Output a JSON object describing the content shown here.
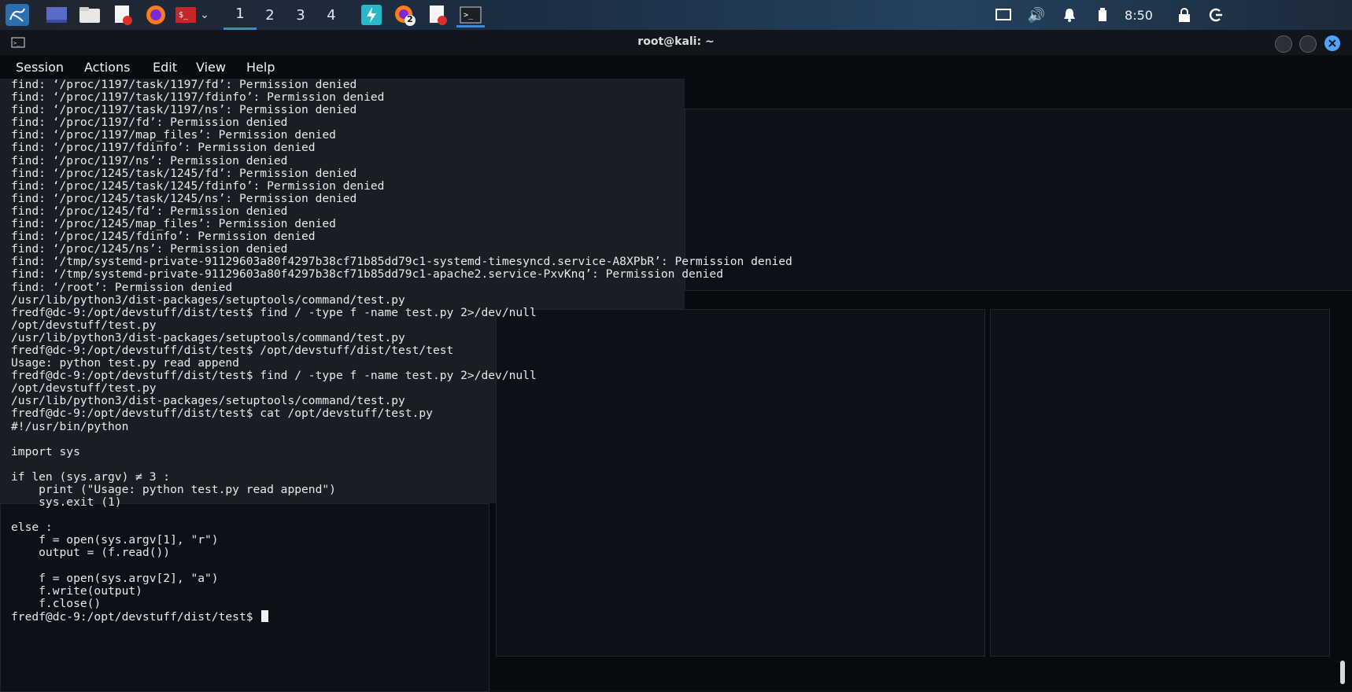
{
  "panel": {
    "apps": [
      "kali-menu-icon",
      "desktop-icon",
      "file-manager-icon",
      "text-editor-icon",
      "firefox-icon",
      "terminal-app-icon",
      "dropdown-chevron-icon"
    ],
    "workspaces": [
      "1",
      "2",
      "3",
      "4"
    ],
    "running_badge": "2",
    "clock": "8:50"
  },
  "window": {
    "title": "root@kali: ~",
    "menu": [
      "Session",
      "Actions",
      "Edit",
      "View",
      "Help"
    ]
  },
  "terminal": {
    "lines": [
      "find: ‘/proc/1197/task/1197/fd’: Permission denied",
      "find: ‘/proc/1197/task/1197/fdinfo’: Permission denied",
      "find: ‘/proc/1197/task/1197/ns’: Permission denied",
      "find: ‘/proc/1197/fd’: Permission denied",
      "find: ‘/proc/1197/map_files’: Permission denied",
      "find: ‘/proc/1197/fdinfo’: Permission denied",
      "find: ‘/proc/1197/ns’: Permission denied",
      "find: ‘/proc/1245/task/1245/fd’: Permission denied",
      "find: ‘/proc/1245/task/1245/fdinfo’: Permission denied",
      "find: ‘/proc/1245/task/1245/ns’: Permission denied",
      "find: ‘/proc/1245/fd’: Permission denied",
      "find: ‘/proc/1245/map_files’: Permission denied",
      "find: ‘/proc/1245/fdinfo’: Permission denied",
      "find: ‘/proc/1245/ns’: Permission denied",
      "find: ‘/tmp/systemd-private-91129603a80f4297b38cf71b85dd79c1-systemd-timesyncd.service-A8XPbR’: Permission denied",
      "find: ‘/tmp/systemd-private-91129603a80f4297b38cf71b85dd79c1-apache2.service-PxvKnq’: Permission denied",
      "find: ‘/root’: Permission denied",
      "/usr/lib/python3/dist-packages/setuptools/command/test.py",
      "fredf@dc-9:/opt/devstuff/dist/test$ find / -type f -name test.py 2>/dev/null",
      "/opt/devstuff/test.py",
      "/usr/lib/python3/dist-packages/setuptools/command/test.py",
      "fredf@dc-9:/opt/devstuff/dist/test$ /opt/devstuff/dist/test/test",
      "Usage: python test.py read append",
      "fredf@dc-9:/opt/devstuff/dist/test$ find / -type f -name test.py 2>/dev/null",
      "/opt/devstuff/test.py",
      "/usr/lib/python3/dist-packages/setuptools/command/test.py",
      "fredf@dc-9:/opt/devstuff/dist/test$ cat /opt/devstuff/test.py",
      "#!/usr/bin/python",
      "",
      "import sys",
      "",
      "if len (sys.argv) ≠ 3 :",
      "    print (\"Usage: python test.py read append\")",
      "    sys.exit (1)",
      "",
      "else :",
      "    f = open(sys.argv[1], \"r\")",
      "    output = (f.read())",
      "",
      "    f = open(sys.argv[2], \"a\")",
      "    f.write(output)",
      "    f.close()"
    ],
    "prompt": "fredf@dc-9:/opt/devstuff/dist/test$ "
  },
  "colors": {
    "background": "#070b10",
    "text": "#e9e9e9",
    "panel_accent": "#3b8ad6"
  }
}
